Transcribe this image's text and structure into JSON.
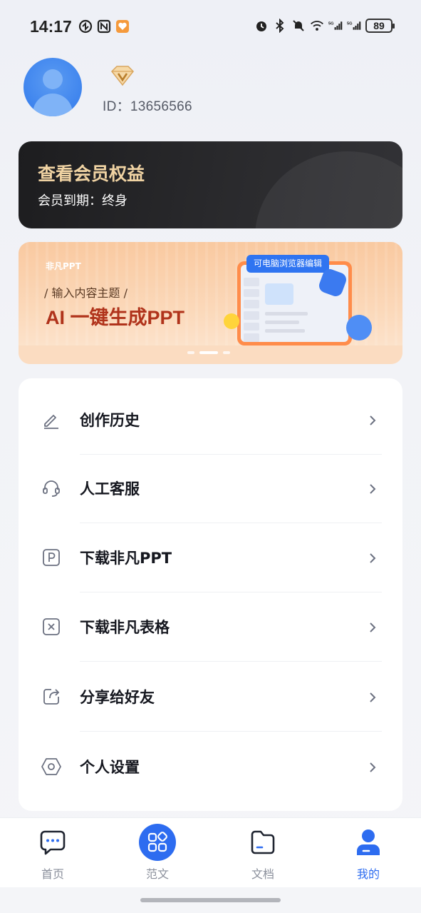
{
  "status_bar": {
    "time": "14:17",
    "battery": "89",
    "left_icons": [
      "nfc-icon",
      "app-icon"
    ],
    "right_icons": [
      "alarm-icon",
      "bluetooth-icon",
      "mute-icon",
      "wifi-icon",
      "signal-5g-icon",
      "signal-5g-icon"
    ]
  },
  "profile": {
    "user_id": "ID：13656566",
    "badge_icon": "vip-diamond-icon"
  },
  "member_card": {
    "title": "查看会员权益",
    "subtitle": "会员到期：终身"
  },
  "banner": {
    "brand": "非凡PPT",
    "tagline": "输入内容主题",
    "headline": "AI 一键生成PPT",
    "chip": "可电脑浏览器编辑",
    "slides": 3,
    "active_slide": 2
  },
  "menu": {
    "items": [
      {
        "label": "创作历史",
        "icon": "pencil-icon"
      },
      {
        "label": "人工客服",
        "icon": "headset-icon"
      },
      {
        "label": "下载非凡PPT",
        "icon": "p-box-icon"
      },
      {
        "label": "下载非凡表格",
        "icon": "x-box-icon"
      },
      {
        "label": "分享给好友",
        "icon": "share-icon"
      },
      {
        "label": "个人设置",
        "icon": "settings-hexagon-icon"
      }
    ]
  },
  "tabbar": {
    "tabs": [
      {
        "label": "首页",
        "icon": "chat-bubble-icon"
      },
      {
        "label": "范文",
        "icon": "grid-icon"
      },
      {
        "label": "文档",
        "icon": "folder-icon"
      },
      {
        "label": "我的",
        "icon": "person-icon"
      }
    ],
    "active": "我的"
  },
  "colors": {
    "accent": "#2d6cf0",
    "member_gold": "#f0d3a3",
    "banner_red": "#b0331b"
  }
}
